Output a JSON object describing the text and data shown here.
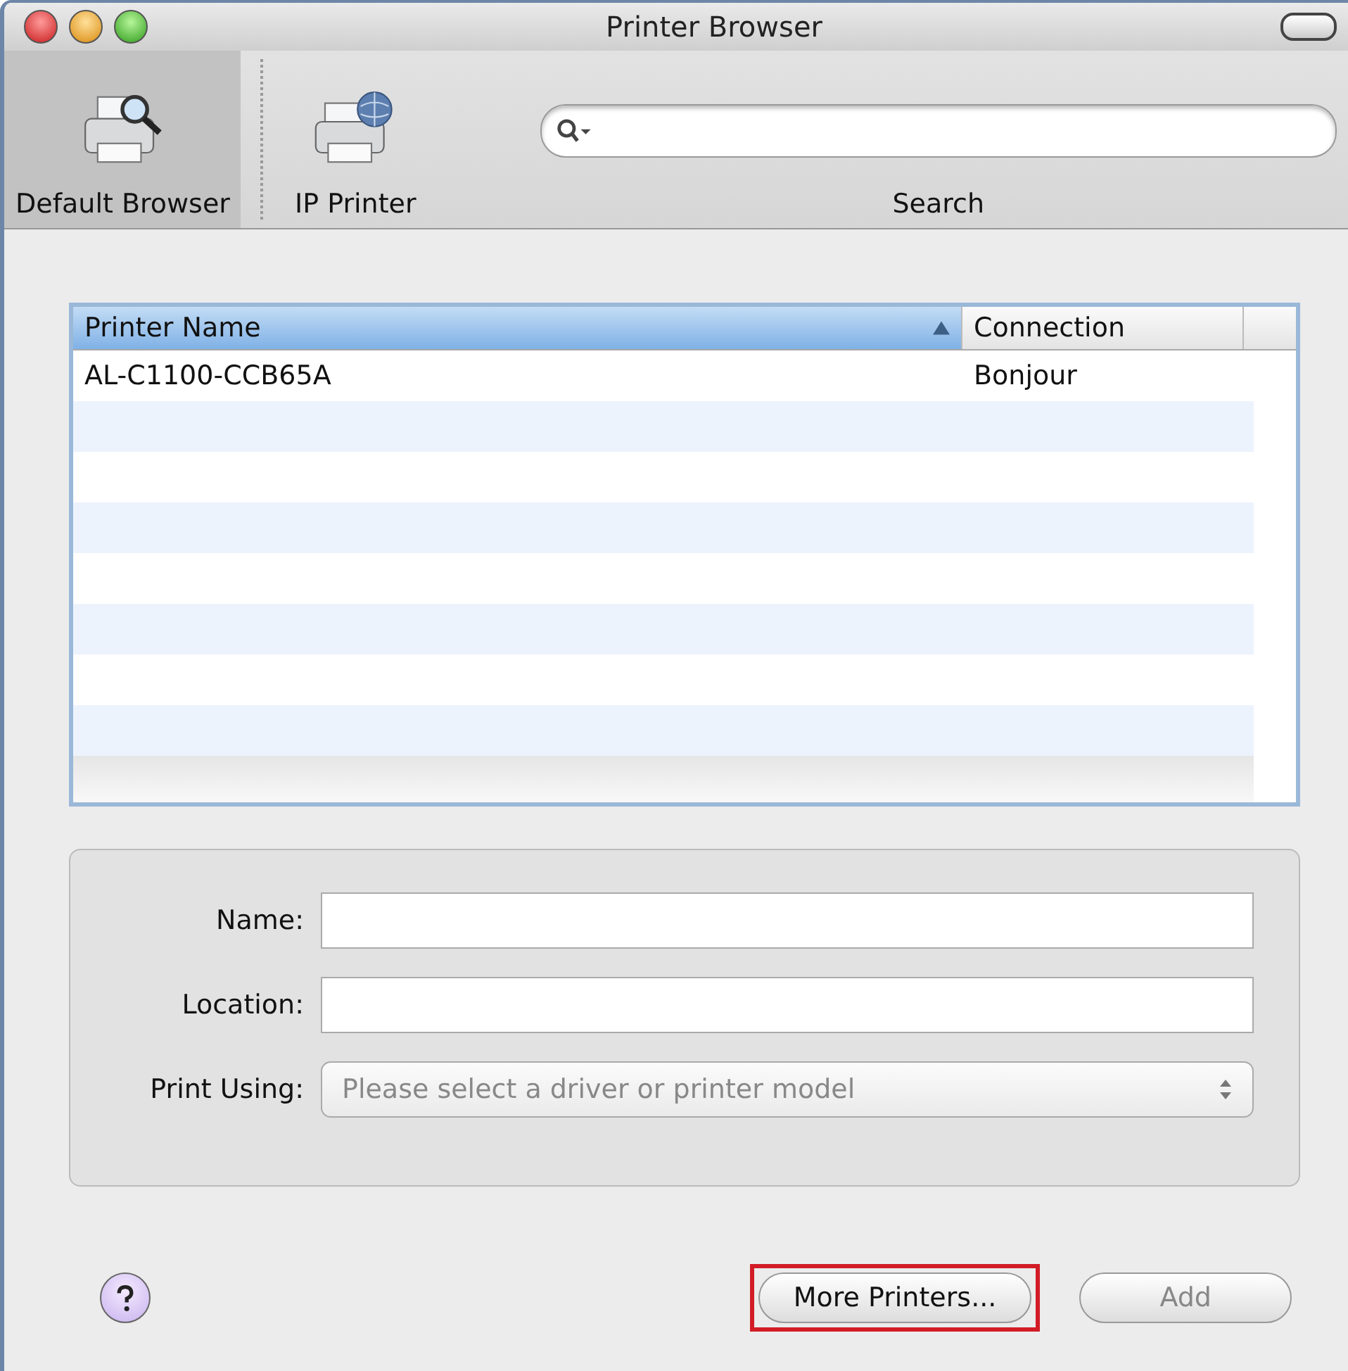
{
  "window": {
    "title": "Printer Browser"
  },
  "toolbar": {
    "items": [
      {
        "label": "Default Browser",
        "selected": true,
        "kind": "browser"
      },
      {
        "label": "IP Printer",
        "selected": false,
        "kind": "ip"
      }
    ],
    "search": {
      "label": "Search"
    }
  },
  "table": {
    "columns": [
      {
        "label": "Printer Name",
        "sorted": true
      },
      {
        "label": "Connection",
        "sorted": false
      }
    ],
    "rows": [
      [
        "AL-C1100-CCB65A",
        "Bonjour"
      ]
    ]
  },
  "form": {
    "fields": [
      {
        "label": "Name:",
        "kind": "text"
      },
      {
        "label": "Location:",
        "kind": "text"
      },
      {
        "label": "Print Using:",
        "kind": "popup",
        "placeholder": "Please select a driver or printer model",
        "disabled": true
      }
    ]
  },
  "buttons": [
    {
      "label": "More Printers...",
      "disabled": false,
      "highlighted": true
    },
    {
      "label": "Add",
      "disabled": true,
      "highlighted": false
    }
  ]
}
